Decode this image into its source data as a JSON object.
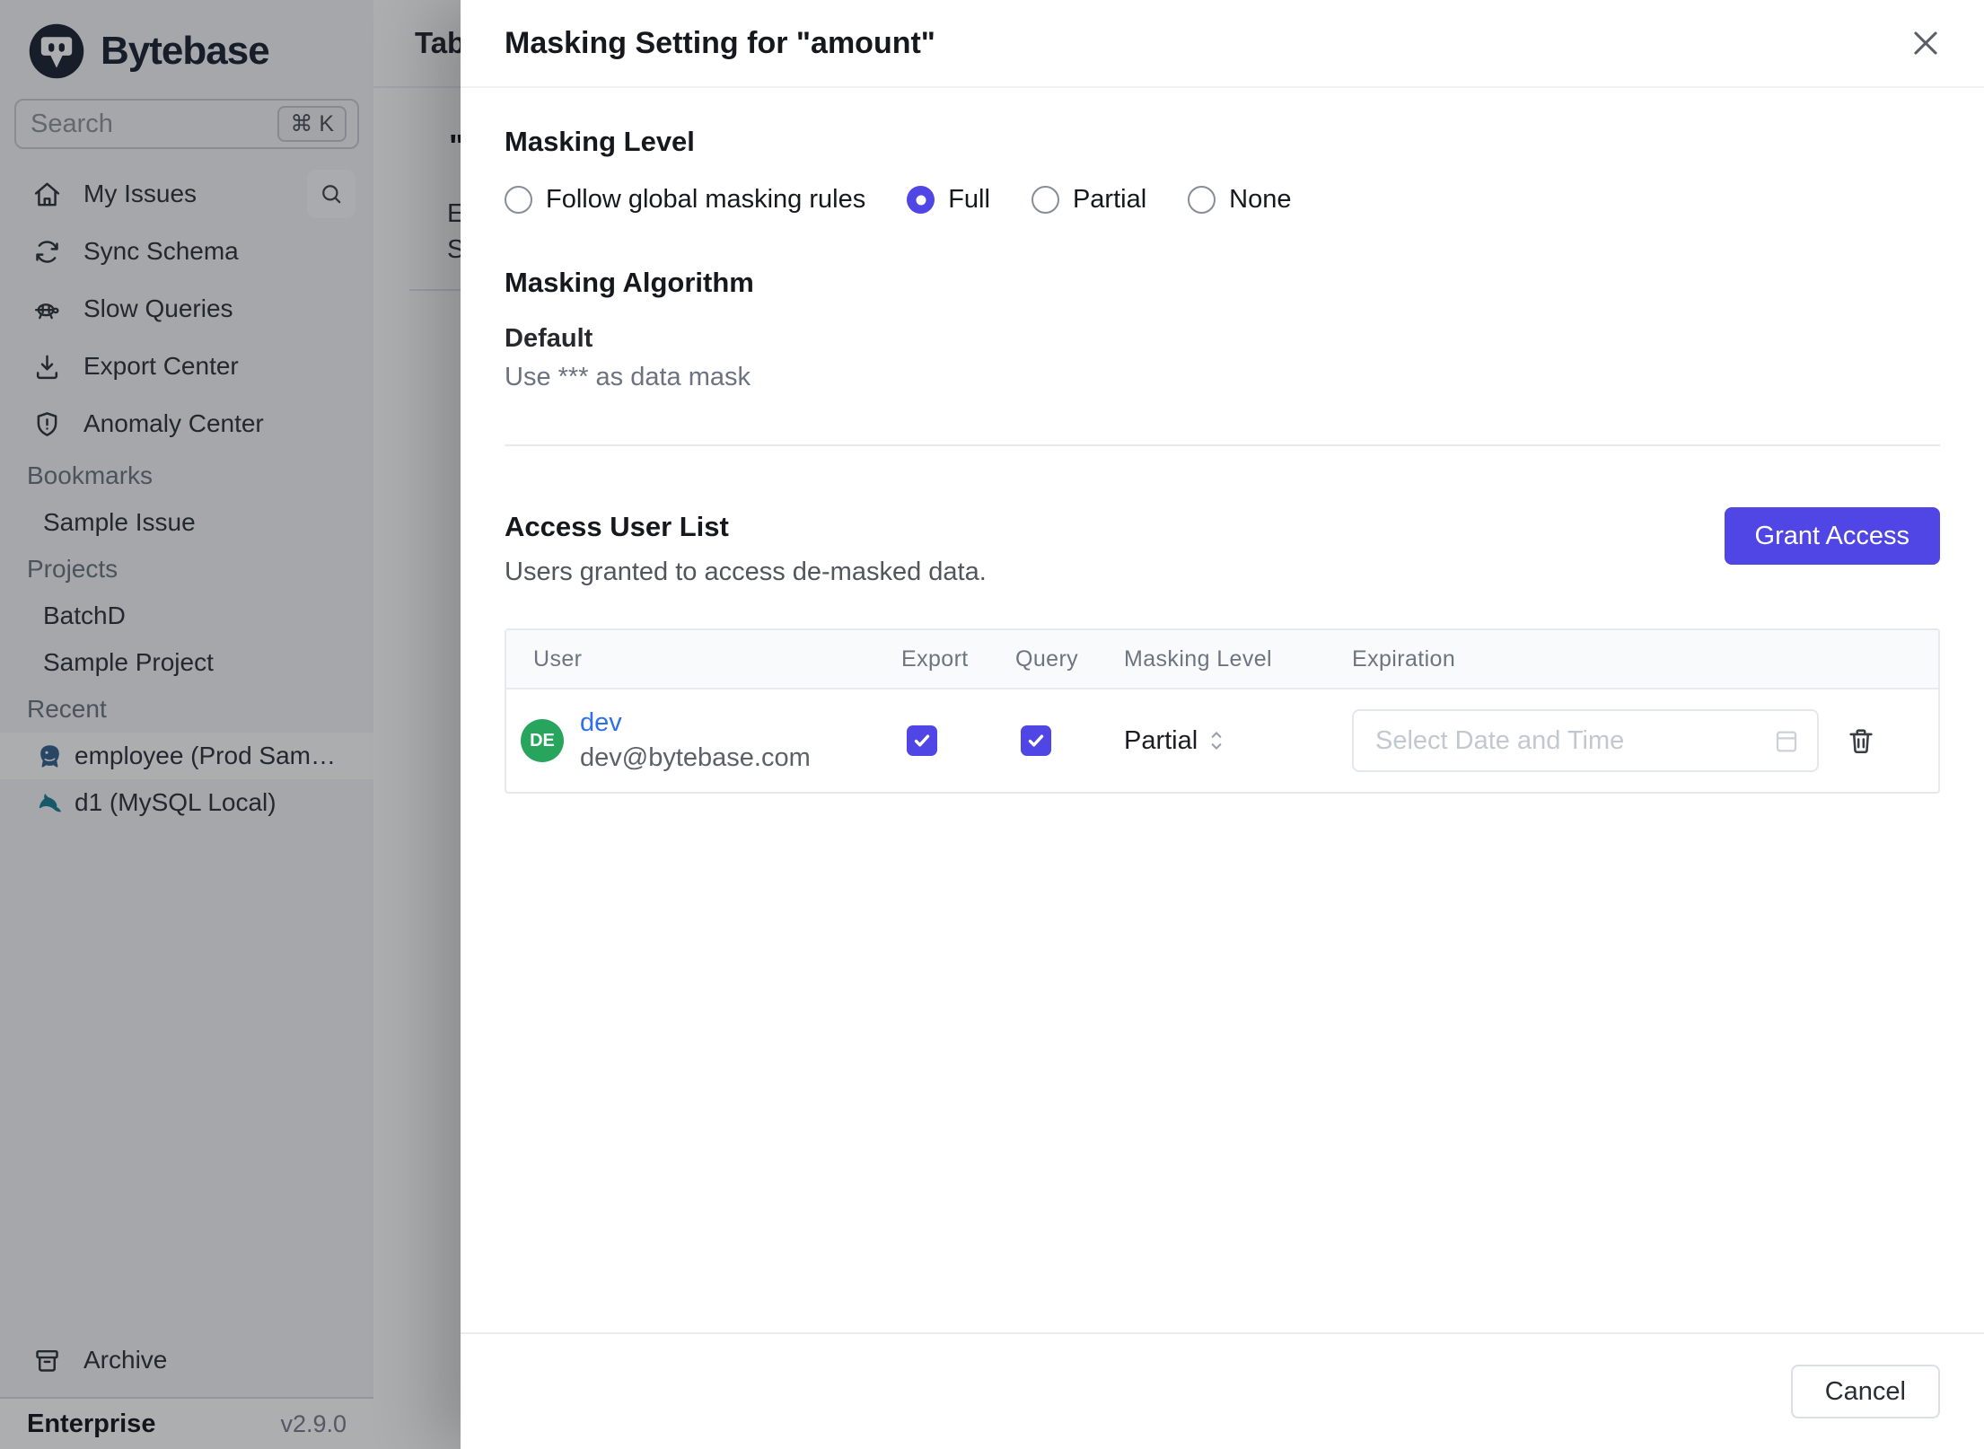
{
  "brand": {
    "name": "Bytebase"
  },
  "sidebar": {
    "search": {
      "placeholder": "Search",
      "shortcut": "⌘ K"
    },
    "menu": [
      {
        "label": "My Issues"
      },
      {
        "label": "Sync Schema"
      },
      {
        "label": "Slow Queries"
      },
      {
        "label": "Export Center"
      },
      {
        "label": "Anomaly Center"
      }
    ],
    "sections": [
      {
        "label": "Bookmarks",
        "items": [
          {
            "label": "Sample Issue"
          }
        ]
      },
      {
        "label": "Projects",
        "items": [
          {
            "label": "BatchD"
          },
          {
            "label": "Sample Project"
          }
        ]
      },
      {
        "label": "Recent",
        "items": [
          {
            "label": "employee (Prod Sam…",
            "db": "postgres"
          },
          {
            "label": "d1 (MySQL Local)",
            "db": "mysql"
          }
        ]
      }
    ],
    "archive": {
      "label": "Archive"
    },
    "footer": {
      "plan": "Enterprise",
      "version": "v2.9.0"
    }
  },
  "background_page": {
    "title": "Tab",
    "fragments": {
      "quote": "\"",
      "line1": "E",
      "line2": "S"
    }
  },
  "modal": {
    "title": "Masking Setting for \"amount\"",
    "masking_level": {
      "heading": "Masking Level",
      "selected": "Full",
      "options": [
        {
          "label": "Follow global masking rules",
          "selected": false
        },
        {
          "label": "Full",
          "selected": true
        },
        {
          "label": "Partial",
          "selected": false
        },
        {
          "label": "None",
          "selected": false
        }
      ]
    },
    "masking_algorithm": {
      "heading": "Masking Algorithm",
      "name": "Default",
      "description": "Use *** as data mask"
    },
    "access": {
      "heading": "Access User List",
      "description": "Users granted to access de-masked data.",
      "grant_button": "Grant Access",
      "table": {
        "columns": [
          "User",
          "Export",
          "Query",
          "Masking Level",
          "Expiration"
        ],
        "rows": [
          {
            "avatar_initials": "DE",
            "name": "dev",
            "email": "dev@bytebase.com",
            "export_checked": true,
            "query_checked": true,
            "masking_level": "Partial",
            "expiration_placeholder": "Select Date and Time"
          }
        ]
      }
    },
    "footer": {
      "cancel": "Cancel"
    }
  },
  "colors": {
    "accent": "#4f46e5",
    "avatar_green": "#27a55c",
    "link_blue": "#2f6fed"
  }
}
